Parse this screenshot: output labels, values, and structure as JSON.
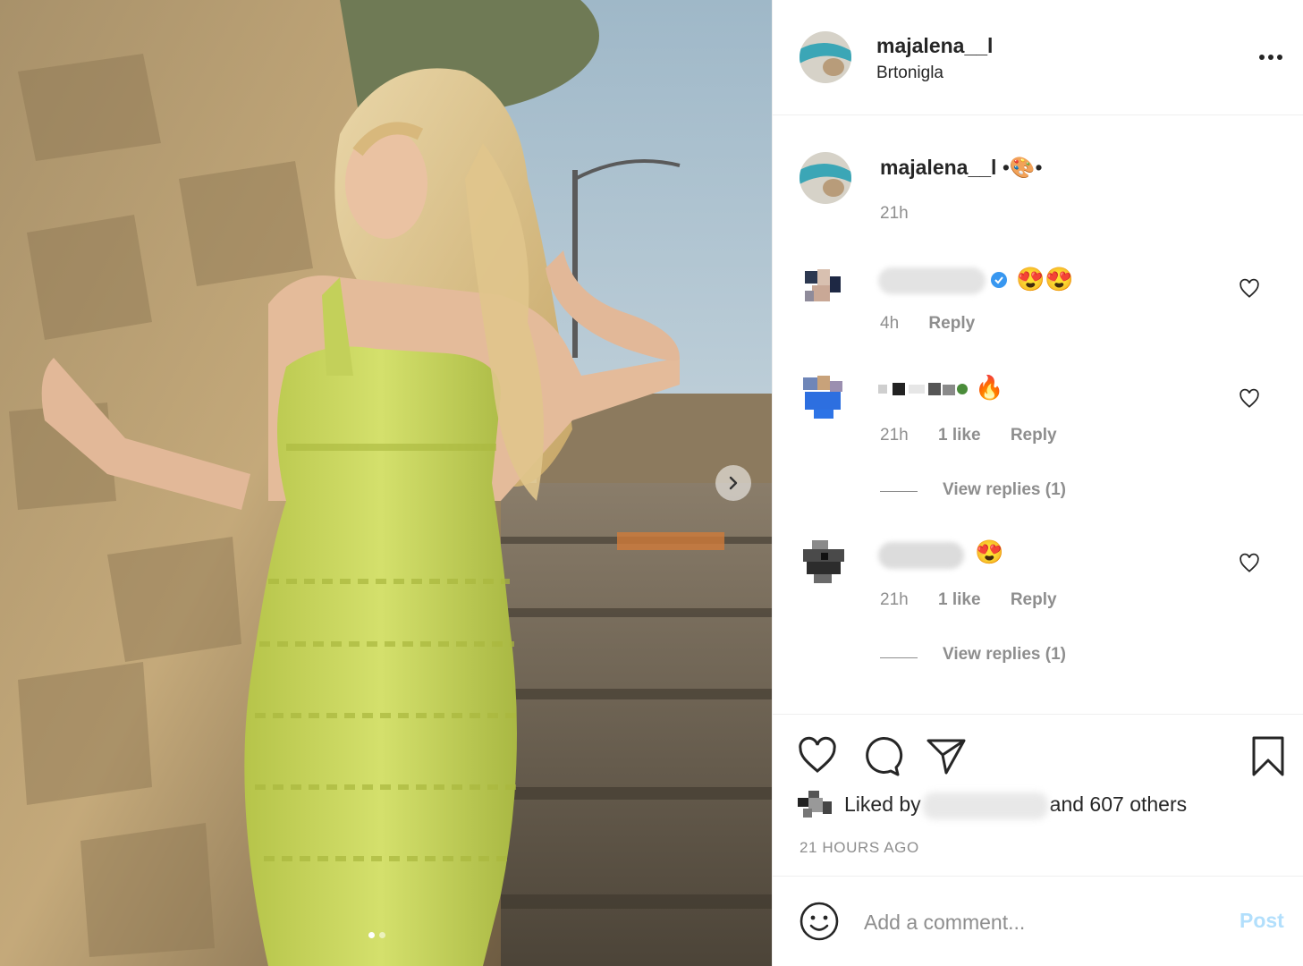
{
  "post": {
    "username": "majalena__l",
    "location": "Brtonigla"
  },
  "caption": {
    "username": "majalena__l",
    "text": "•🎨•",
    "time": "21h"
  },
  "comments": [
    {
      "time": "4h",
      "reply_label": "Reply",
      "emoji": "😍😍",
      "verified": true
    },
    {
      "time": "21h",
      "likes": "1 like",
      "reply_label": "Reply",
      "emoji": "🔥",
      "view_replies": "View replies (1)"
    },
    {
      "time": "21h",
      "likes": "1 like",
      "reply_label": "Reply",
      "emoji": "😍",
      "view_replies": "View replies (1)"
    }
  ],
  "engagement": {
    "liked_by_prefix": "Liked by",
    "liked_by_suffix": "and 607 others",
    "timestamp": "21 HOURS AGO"
  },
  "composer": {
    "placeholder": "Add a comment...",
    "post_label": "Post"
  },
  "icons": {
    "more": "more-options-icon",
    "like": "heart-icon",
    "comment": "comment-bubble-icon",
    "share": "paper-plane-icon",
    "save": "bookmark-icon",
    "emoji": "smiley-icon",
    "next": "chevron-right-icon"
  },
  "colors": {
    "dress": "#c8d65a",
    "verified": "#3897f0",
    "post_disabled": "#b2dffc"
  },
  "carousel": {
    "current_slide": 1,
    "total_slides": 2
  }
}
